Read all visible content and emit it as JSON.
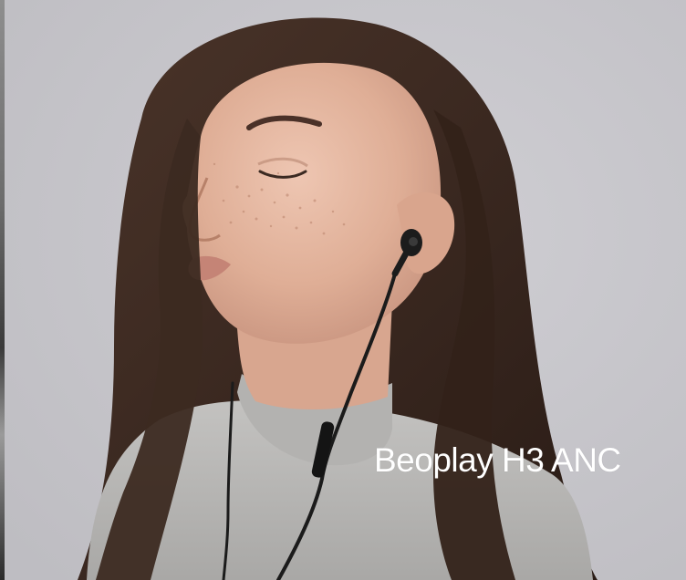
{
  "image": {
    "background_color": "#c7c6cb",
    "subject": "woman-with-in-ear-headphones",
    "colors": {
      "hair": "#3b2a22",
      "skin": "#e2b39c",
      "sweater": "#b9b8b6",
      "cable": "#1b1b1b"
    }
  },
  "caption": {
    "text": "Beoplay H3 ANC"
  }
}
